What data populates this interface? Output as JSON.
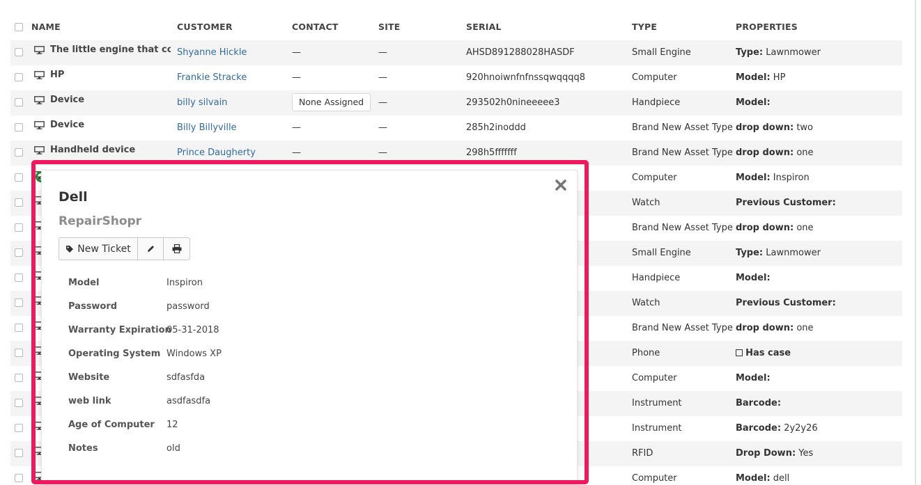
{
  "columns": {
    "name": "NAME",
    "customer": "CUSTOMER",
    "contact": "CONTACT",
    "site": "SITE",
    "serial": "SERIAL",
    "type": "TYPE",
    "properties": "PROPERTIES"
  },
  "rows": [
    {
      "name": "The little engine that could",
      "customer": "Shyanne Hickle",
      "contact": "—",
      "site": "—",
      "serial": "AHSD891288028HASDF",
      "type": "Small Engine",
      "prop_label": "Type:",
      "prop_value": " Lawnmower"
    },
    {
      "name": "HP",
      "customer": "Frankie Stracke",
      "contact": "—",
      "site": "—",
      "serial": "920hnoiwnfnfnssqwqqqq8",
      "type": "Computer",
      "prop_label": "Model:",
      "prop_value": " HP"
    },
    {
      "name": "Device",
      "customer": "billy silvain",
      "contact": "None Assigned",
      "site": "—",
      "serial": "293502h0nineeeee3",
      "type": "Handpiece",
      "prop_label": "Model:",
      "prop_value": ""
    },
    {
      "name": "Device",
      "customer": "Billy Billyville",
      "contact": "—",
      "site": "—",
      "serial": "285h2inoddd",
      "type": "Brand New Asset Type",
      "prop_label": "drop down:",
      "prop_value": " two"
    },
    {
      "name": "Handheld device",
      "customer": "Prince Daugherty",
      "contact": "—",
      "site": "—",
      "serial": "298h5fffffff",
      "type": "Brand New Asset Type",
      "prop_label": "drop down:",
      "prop_value": " one"
    },
    {
      "type": "Computer",
      "prop_label": "Model:",
      "prop_value": " Inspiron"
    },
    {
      "type": "Watch",
      "prop_label": "Previous Customer:",
      "prop_value": ""
    },
    {
      "type": "Brand New Asset Type",
      "prop_label": "drop down:",
      "prop_value": " one"
    },
    {
      "type": "Small Engine",
      "prop_label": "Type:",
      "prop_value": " Lawnmower"
    },
    {
      "type": "Handpiece",
      "prop_label": "Model:",
      "prop_value": ""
    },
    {
      "type": "Watch",
      "prop_label": "Previous Customer:",
      "prop_value": ""
    },
    {
      "type": "Brand New Asset Type",
      "prop_label": "drop down:",
      "prop_value": " one"
    },
    {
      "type": "Phone",
      "prop_label": "Has case",
      "prop_value": "",
      "prop_checkbox": true
    },
    {
      "type": "Computer",
      "prop_label": "Model:",
      "prop_value": ""
    },
    {
      "type": "Instrument",
      "prop_label": "Barcode:",
      "prop_value": ""
    },
    {
      "type": "Instrument",
      "prop_label": "Barcode:",
      "prop_value": " 2y2y26"
    },
    {
      "type": "RFID",
      "prop_label": "Drop Down:",
      "prop_value": " Yes"
    },
    {
      "type": "Computer",
      "prop_label": "Model:",
      "prop_value": " dell"
    }
  ],
  "popup": {
    "title": "Dell",
    "subtitle": "RepairShopr",
    "new_ticket_label": "New Ticket",
    "details": [
      {
        "label": "Model",
        "value": "Inspiron",
        "link": false
      },
      {
        "label": "Password",
        "value": "password",
        "link": false
      },
      {
        "label": "Warranty Expiration",
        "value": "05-31-2018",
        "link": false
      },
      {
        "label": "Operating System",
        "value": "Windows XP",
        "link": false
      },
      {
        "label": "Website",
        "value": "sdfasfda",
        "link": true
      },
      {
        "label": "web link",
        "value": "asdfasdfa",
        "link": true
      },
      {
        "label": "Age of Computer",
        "value": "12",
        "link": false
      },
      {
        "label": "Notes",
        "value": "old",
        "link": false
      }
    ]
  },
  "colors": {
    "highlight": "#f0185f",
    "link": "#336b9e",
    "stripe": "#f4f4f4"
  },
  "icons": [
    "monitor-icon",
    "tag-icon",
    "pencil-icon",
    "printer-icon",
    "close-icon"
  ]
}
